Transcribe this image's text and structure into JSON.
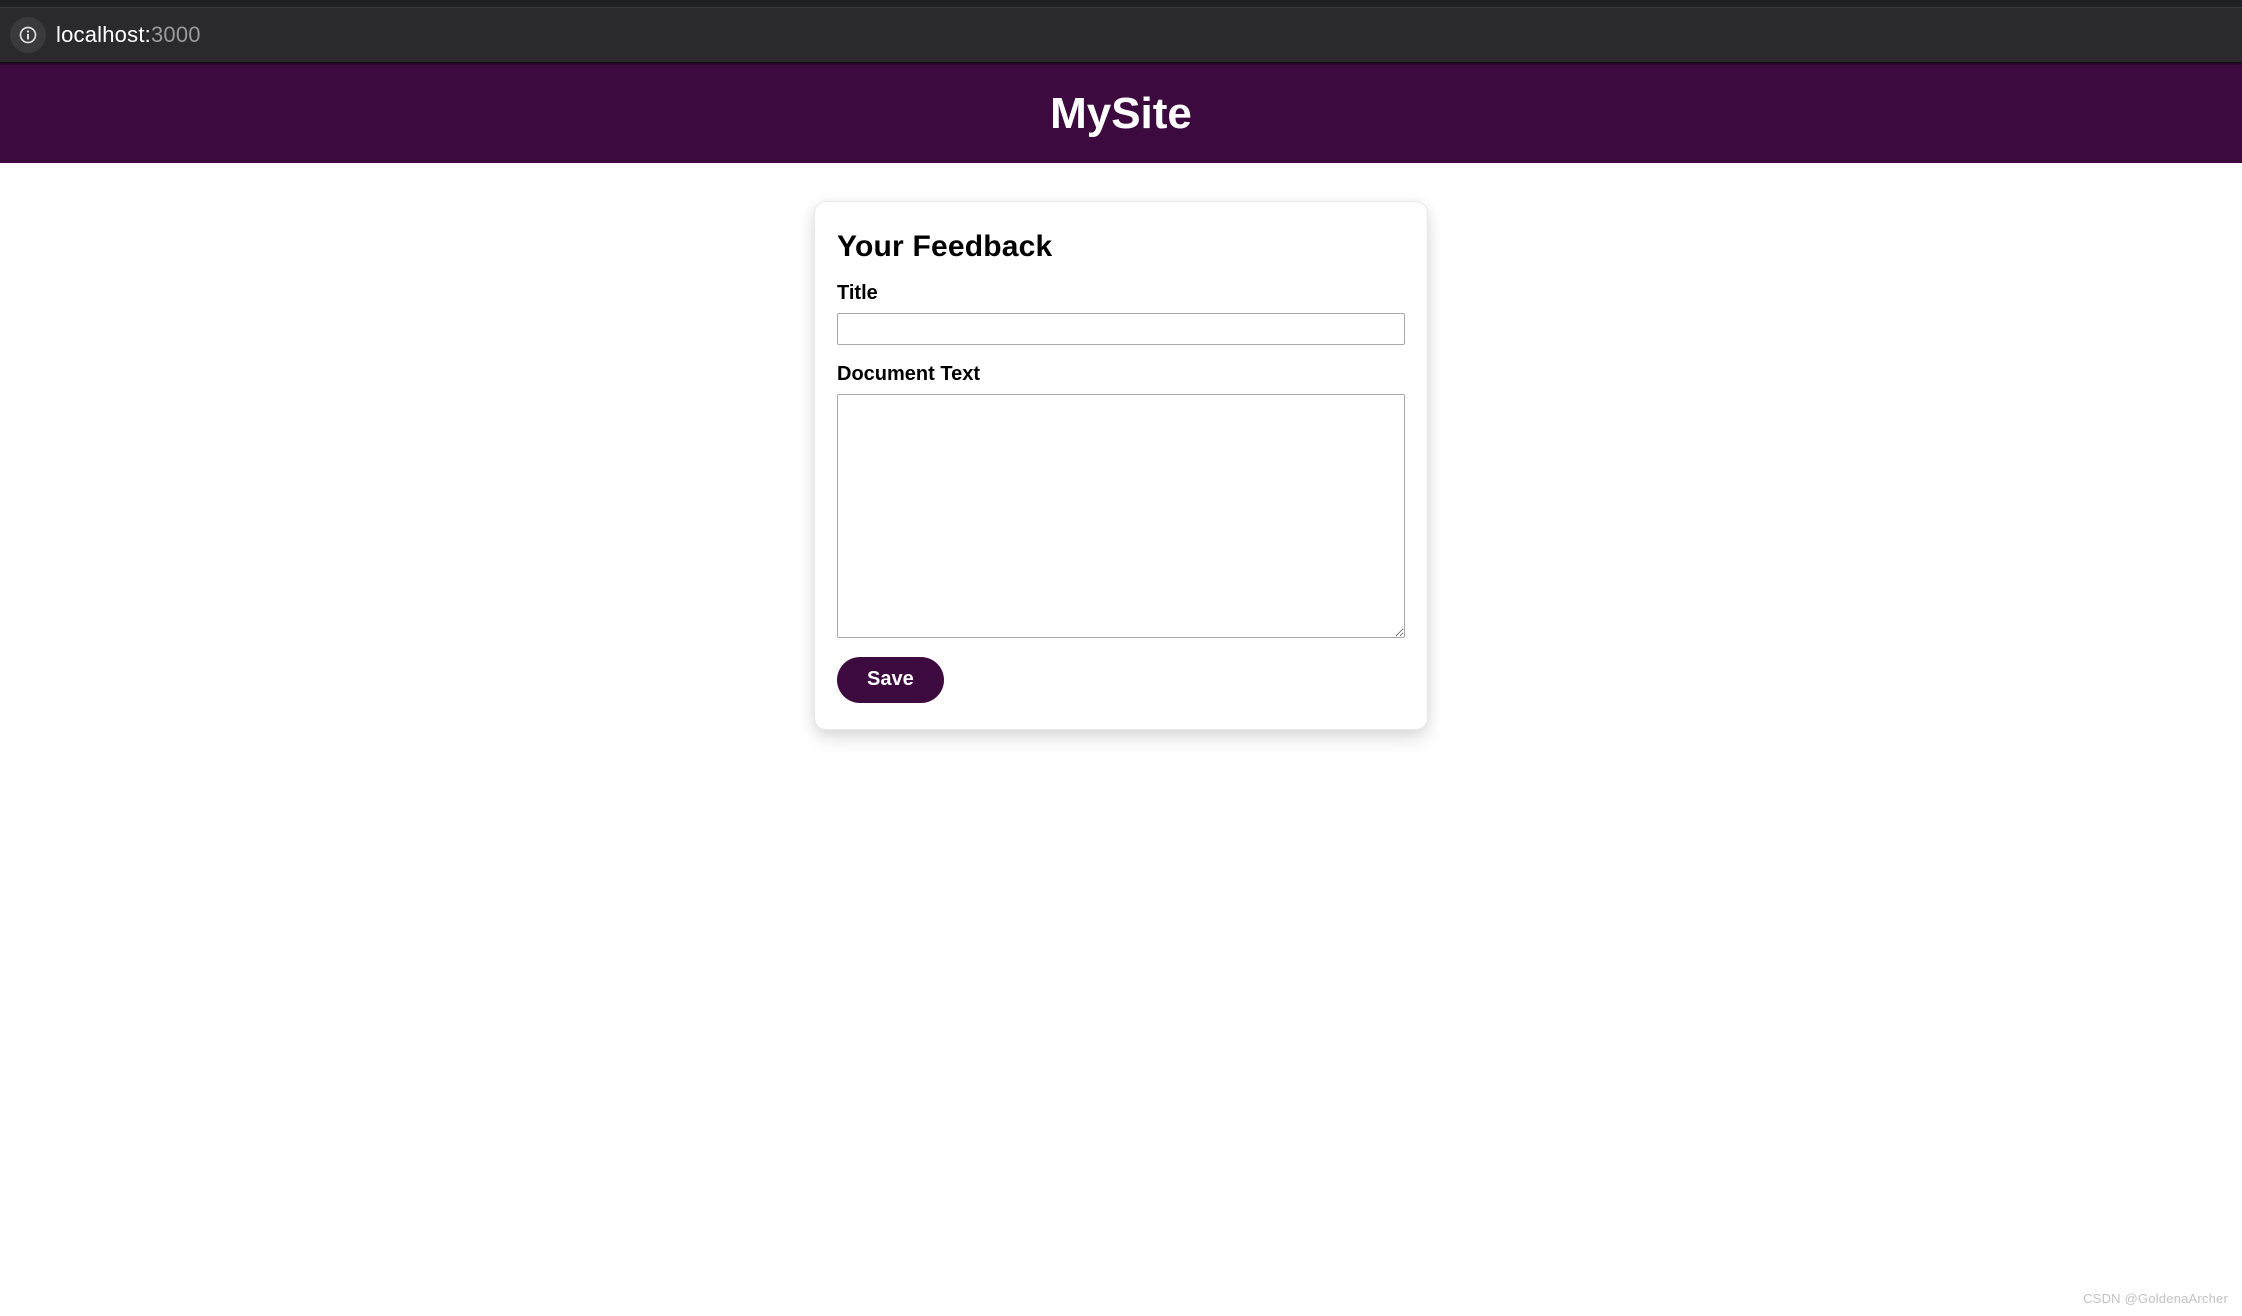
{
  "browser": {
    "url_host": "localhost:",
    "url_port": "3000",
    "info_icon": "info-icon"
  },
  "header": {
    "title": "MySite"
  },
  "form": {
    "heading": "Your Feedback",
    "title_label": "Title",
    "title_value": "",
    "doc_label": "Document Text",
    "doc_value": "",
    "save_label": "Save"
  },
  "footer": {
    "watermark": "CSDN @GoldenaArcher"
  },
  "colors": {
    "brand": "#3d0a3f",
    "chrome": "#2a2a2c"
  }
}
